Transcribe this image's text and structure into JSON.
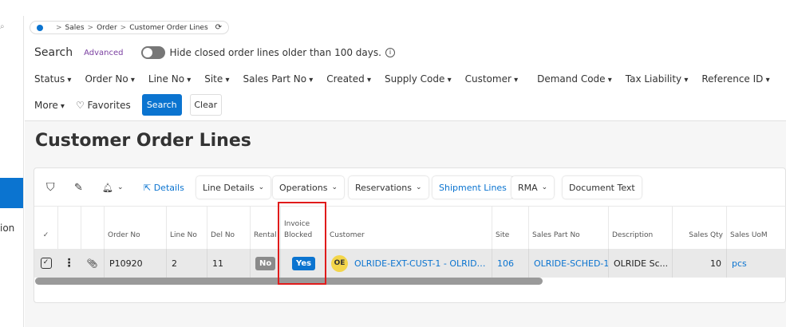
{
  "sidebar": {
    "search_icon": "⌕",
    "partial_label": "ion"
  },
  "breadcrumb": {
    "items": [
      "Sales",
      "Order",
      "Customer Order Lines"
    ],
    "separator": ">",
    "refresh_icon": "⟳"
  },
  "search": {
    "label": "Search",
    "advanced": "Advanced",
    "toggle_text": "Hide closed order lines older than 100 days.",
    "info_icon": "i"
  },
  "filters": [
    "Status",
    "Order No",
    "Line No",
    "Site",
    "Sales Part No",
    "Created",
    "Supply Code",
    "Customer",
    "Demand Code",
    "Tax Liability",
    "Reference ID"
  ],
  "filter_row2": {
    "more": "More",
    "favorites": "♡ Favorites",
    "search_button": "Search",
    "clear_button": "Clear"
  },
  "page_title": "Customer Order Lines",
  "toolbar": {
    "filter_icon": "⛉",
    "edit_icon": "✎",
    "bell_icon": "🔔︎",
    "bell_chevron": "⌄",
    "details": "⇱ Details",
    "line_details": "Line Details",
    "operations": "Operations",
    "reservations": "Reservations",
    "shipment_lines": "Shipment Lines",
    "rma": "RMA",
    "document_text": "Document Text",
    "chevron": "⌄"
  },
  "table": {
    "select_all": "✓",
    "columns": [
      "Order No",
      "Line No",
      "Del No",
      "Rental",
      "Invoice Blocked",
      "Customer",
      "Site",
      "Sales Part No",
      "Description",
      "Sales Qty",
      "Sales UoM"
    ],
    "row": {
      "check": "✓",
      "menu": "⋮",
      "attach": "📎︎",
      "order_no": "P10920",
      "line_no": "2",
      "del_no": "11",
      "rental": "No",
      "invoice_blocked": "Yes",
      "customer_avatar": "OE",
      "customer": "OLRIDE-EXT-CUST-1 - OLRIDE Ex...",
      "site": "106",
      "sales_part_no": "OLRIDE-SCHED-1",
      "description": "OLRIDE Sc...",
      "sales_qty": "10",
      "sales_uom": "pcs"
    }
  },
  "colors": {
    "accent": "#0b74d0",
    "highlight": "#e01b1b",
    "advanced": "#7a3fa0"
  }
}
